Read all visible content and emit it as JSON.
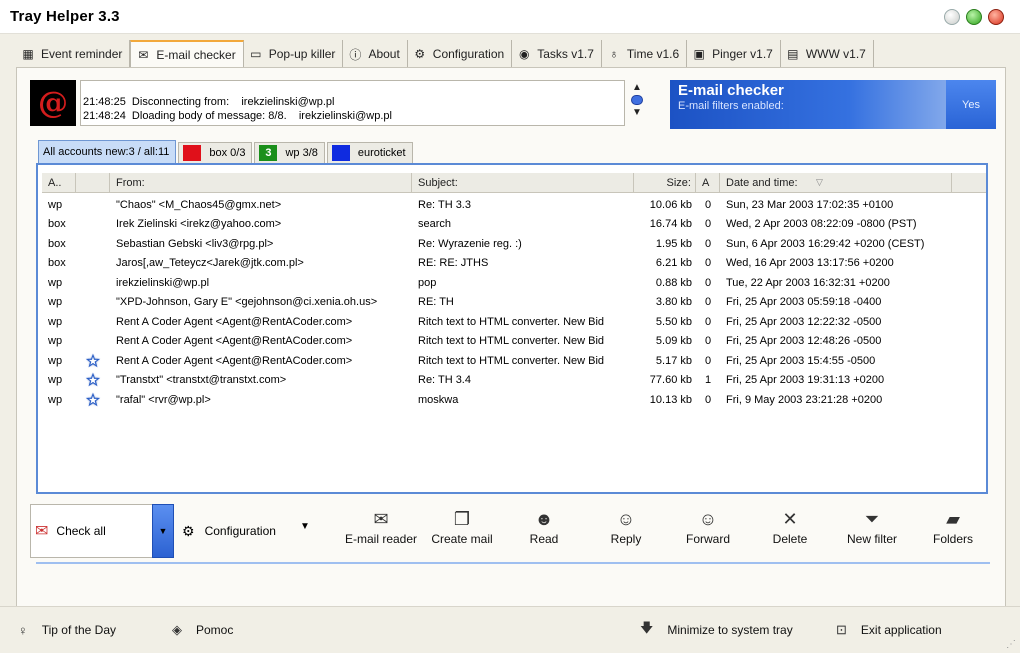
{
  "app": {
    "title": "Tray Helper  3.3"
  },
  "tabs": [
    {
      "label": "Event reminder",
      "icon": "calendar-icon",
      "glyph": "▦"
    },
    {
      "label": "E-mail checker",
      "icon": "mail-monitor-icon",
      "glyph": "✉"
    },
    {
      "label": "Pop-up killer",
      "icon": "popup-icon",
      "glyph": "▭"
    },
    {
      "label": "About",
      "icon": "info-icon",
      "glyph": "ⓘ"
    },
    {
      "label": "Configuration",
      "icon": "config-icon",
      "glyph": "⚙"
    },
    {
      "label": "Tasks v1.7",
      "icon": "tasks-icon",
      "glyph": "◉"
    },
    {
      "label": "Time v1.6",
      "icon": "time-icon",
      "glyph": "♁"
    },
    {
      "label": "Pinger v1.7",
      "icon": "pinger-icon",
      "glyph": "▣"
    },
    {
      "label": "WWW v1.7",
      "icon": "www-icon",
      "glyph": "▤"
    }
  ],
  "log": {
    "line1": "21:48:25  Disconnecting from:    irekzielinski@wp.pl",
    "line2": "21:48:24  Dloading body of message: 8/8.    irekzielinski@wp.pl"
  },
  "infobox": {
    "title": "E-mail checker",
    "subtitle": "E-mail filters enabled:",
    "value": "Yes"
  },
  "accounts": [
    {
      "label": "All accounts  new:3 / all:11",
      "swatch": "",
      "swatch_text": ""
    },
    {
      "label": "box  0/3",
      "swatch": "#e0101a",
      "swatch_text": ""
    },
    {
      "label": "wp  3/8",
      "swatch": "#1a8f1a",
      "swatch_text": "3"
    },
    {
      "label": "euroticket",
      "swatch": "#0f2be0",
      "swatch_text": ""
    }
  ],
  "columns": [
    "A..",
    "From:",
    "Subject:",
    "Size:",
    "A",
    "Date and time:"
  ],
  "messages": [
    {
      "account": "wp",
      "star": false,
      "from": "\"Chaos\" <M_Chaos45@gmx.net>",
      "subject": "Re: TH 3.3",
      "size": "10.06 kb",
      "a": "0",
      "date": "Sun, 23 Mar 2003 17:02:35 +0100"
    },
    {
      "account": "box",
      "star": false,
      "from": "Irek Zielinski <irekz@yahoo.com>",
      "subject": "search",
      "size": "16.74 kb",
      "a": "0",
      "date": "Wed, 2 Apr 2003 08:22:09 -0800 (PST)"
    },
    {
      "account": "box",
      "star": false,
      "from": "Sebastian Gebski <liv3@rpg.pl>",
      "subject": "Re: Wyrazenie reg. :)",
      "size": "1.95 kb",
      "a": "0",
      "date": "Sun, 6 Apr 2003 16:29:42 +0200 (CEST)"
    },
    {
      "account": "box",
      "star": false,
      "from": "Jaros[,aw_Teteycz<Jarek@jtk.com.pl>",
      "subject": "RE: RE: JTHS",
      "size": "6.21 kb",
      "a": "0",
      "date": "Wed, 16 Apr 2003 13:17:56 +0200"
    },
    {
      "account": "wp",
      "star": false,
      "from": "irekzielinski@wp.pl",
      "subject": "pop",
      "size": "0.88 kb",
      "a": "0",
      "date": "Tue, 22 Apr 2003 16:32:31 +0200"
    },
    {
      "account": "wp",
      "star": false,
      "from": "\"XPD-Johnson, Gary E\" <gejohnson@ci.xenia.oh.us>",
      "subject": "RE: TH",
      "size": "3.80 kb",
      "a": "0",
      "date": "Fri, 25 Apr 2003 05:59:18 -0400"
    },
    {
      "account": "wp",
      "star": false,
      "from": "Rent A Coder Agent <Agent@RentACoder.com>",
      "subject": "Ritch text to HTML converter. New Bid",
      "size": "5.50 kb",
      "a": "0",
      "date": "Fri, 25 Apr 2003 12:22:32 -0500"
    },
    {
      "account": "wp",
      "star": false,
      "from": "Rent A Coder Agent <Agent@RentACoder.com>",
      "subject": "Ritch text to HTML converter. New Bid",
      "size": "5.09 kb",
      "a": "0",
      "date": "Fri, 25 Apr 2003 12:48:26 -0500"
    },
    {
      "account": "wp",
      "star": true,
      "from": "Rent A Coder Agent <Agent@RentACoder.com>",
      "subject": "Ritch text to HTML converter. New Bid",
      "size": "5.17 kb",
      "a": "0",
      "date": "Fri, 25 Apr 2003 15:4:55 -0500"
    },
    {
      "account": "wp",
      "star": true,
      "from": "\"Transtxt\" <transtxt@transtxt.com>",
      "subject": "Re: TH 3.4",
      "size": "77.60 kb",
      "a": "1",
      "date": "Fri, 25 Apr 2003 19:31:13 +0200"
    },
    {
      "account": "wp",
      "star": true,
      "from": "\"rafal\" <rvr@wp.pl>",
      "subject": "moskwa",
      "size": "10.13 kb",
      "a": "0",
      "date": "Fri, 9 May 2003 23:21:28 +0200"
    }
  ],
  "toolbar": {
    "check_all": "Check all",
    "configuration": "Configuration",
    "buttons": [
      {
        "label": "E-mail reader",
        "icon": "mail-reader-icon",
        "glyph": "✉"
      },
      {
        "label": "Create mail",
        "icon": "create-mail-icon",
        "glyph": "❐"
      },
      {
        "label": "Read",
        "icon": "read-icon",
        "glyph": "☻"
      },
      {
        "label": "Reply",
        "icon": "reply-icon",
        "glyph": "☺"
      },
      {
        "label": "Forward",
        "icon": "forward-icon",
        "glyph": "☺"
      },
      {
        "label": "Delete",
        "icon": "delete-icon",
        "glyph": "✕"
      },
      {
        "label": "New filter",
        "icon": "filter-icon",
        "glyph": "⏷"
      },
      {
        "label": "Folders",
        "icon": "folders-icon",
        "glyph": "▰"
      }
    ]
  },
  "status": {
    "tip": "Tip of the Day",
    "help": "Pomoc",
    "minimize": "Minimize to system tray",
    "exit": "Exit application"
  }
}
